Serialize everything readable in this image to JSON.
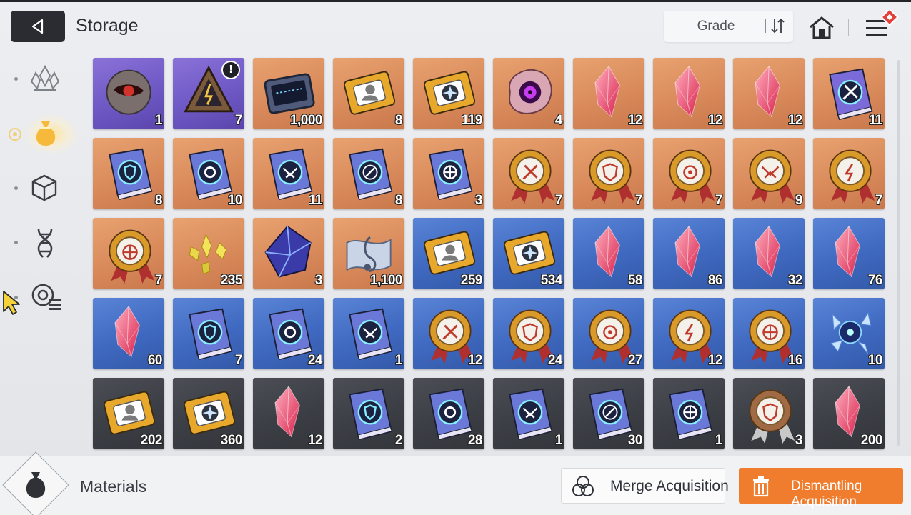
{
  "header": {
    "title": "Storage",
    "grade_label": "Grade"
  },
  "sidebar": {
    "items": [
      {
        "name": "crystals-tab",
        "icon": "crystal-cluster-icon",
        "active": false
      },
      {
        "name": "materials-tab",
        "icon": "pouch-icon",
        "active": true
      },
      {
        "name": "cube-tab",
        "icon": "cube-icon",
        "active": false
      },
      {
        "name": "dna-tab",
        "icon": "dna-icon",
        "active": false
      },
      {
        "name": "list-tab",
        "icon": "badge-list-icon",
        "active": false
      }
    ]
  },
  "items": [
    {
      "grade": "purple",
      "icon": "rock-orb-icon",
      "qty": "1"
    },
    {
      "grade": "purple",
      "icon": "triangle-core-icon",
      "qty": "7",
      "alert": "!"
    },
    {
      "grade": "orange",
      "icon": "chip-icon",
      "qty": "1,000"
    },
    {
      "grade": "orange",
      "icon": "portrait-ticket-icon",
      "qty": "8"
    },
    {
      "grade": "orange",
      "icon": "star-ticket-icon",
      "qty": "119"
    },
    {
      "grade": "orange",
      "icon": "eye-blob-icon",
      "qty": "4"
    },
    {
      "grade": "orange",
      "icon": "red-crystal-icon",
      "qty": "12"
    },
    {
      "grade": "orange",
      "icon": "amber-crystal-icon",
      "qty": "12"
    },
    {
      "grade": "orange",
      "icon": "violet-crystal-icon",
      "qty": "12"
    },
    {
      "grade": "orange",
      "icon": "sword-book-icon",
      "qty": "11"
    },
    {
      "grade": "orange",
      "icon": "shield-book-icon",
      "qty": "8"
    },
    {
      "grade": "orange",
      "icon": "target-book-icon",
      "qty": "10"
    },
    {
      "grade": "orange",
      "icon": "wing-book-icon",
      "qty": "11"
    },
    {
      "grade": "orange",
      "icon": "bolt-book-icon",
      "qty": "8"
    },
    {
      "grade": "orange",
      "icon": "circle-book-icon",
      "qty": "3"
    },
    {
      "grade": "orange",
      "icon": "sword-medal-icon",
      "qty": "7"
    },
    {
      "grade": "orange",
      "icon": "shield-medal-icon",
      "qty": "7"
    },
    {
      "grade": "orange",
      "icon": "target-medal-icon",
      "qty": "7"
    },
    {
      "grade": "orange",
      "icon": "wing-medal-icon",
      "qty": "9"
    },
    {
      "grade": "orange",
      "icon": "bolt-medal-icon",
      "qty": "7"
    },
    {
      "grade": "orange",
      "icon": "circle-medal-icon",
      "qty": "7"
    },
    {
      "grade": "orange",
      "icon": "shards-icon",
      "qty": "235"
    },
    {
      "grade": "orange",
      "icon": "blue-polyhedron-icon",
      "qty": "3"
    },
    {
      "grade": "orange",
      "icon": "music-scroll-icon",
      "qty": "1,100"
    },
    {
      "grade": "blue",
      "icon": "portrait-ticket-icon",
      "qty": "259"
    },
    {
      "grade": "blue",
      "icon": "star-ticket-icon",
      "qty": "534"
    },
    {
      "grade": "blue",
      "icon": "red-crystal-icon",
      "qty": "58"
    },
    {
      "grade": "blue",
      "icon": "amber-crystal-icon",
      "qty": "86"
    },
    {
      "grade": "blue",
      "icon": "violet-crystal-icon",
      "qty": "32"
    },
    {
      "grade": "blue",
      "icon": "green-crystal-icon",
      "qty": "76"
    },
    {
      "grade": "blue",
      "icon": "cyan-crystal-icon",
      "qty": "60"
    },
    {
      "grade": "blue",
      "icon": "shield-book-icon",
      "qty": "7"
    },
    {
      "grade": "blue",
      "icon": "target-book-icon",
      "qty": "24"
    },
    {
      "grade": "blue",
      "icon": "wing-book-icon",
      "qty": "1"
    },
    {
      "grade": "blue",
      "icon": "sword-medal-icon",
      "qty": "12"
    },
    {
      "grade": "blue",
      "icon": "shield-medal-icon",
      "qty": "24"
    },
    {
      "grade": "blue",
      "icon": "target-medal-icon",
      "qty": "27"
    },
    {
      "grade": "blue",
      "icon": "bolt-medal-icon",
      "qty": "12"
    },
    {
      "grade": "blue",
      "icon": "circle-medal-icon",
      "qty": "16"
    },
    {
      "grade": "blue",
      "icon": "shattered-orb-icon",
      "qty": "10"
    },
    {
      "grade": "gray",
      "icon": "portrait-ticket-icon",
      "qty": "202"
    },
    {
      "grade": "gray",
      "icon": "star-ticket-icon",
      "qty": "360"
    },
    {
      "grade": "gray",
      "icon": "ember-crystal-icon",
      "qty": "12"
    },
    {
      "grade": "gray",
      "icon": "shield-book-icon",
      "qty": "2"
    },
    {
      "grade": "gray",
      "icon": "target-book-icon",
      "qty": "28"
    },
    {
      "grade": "gray",
      "icon": "wing-book-icon",
      "qty": "1"
    },
    {
      "grade": "gray",
      "icon": "bolt-book-icon",
      "qty": "30"
    },
    {
      "grade": "gray",
      "icon": "circle-book-icon",
      "qty": "1"
    },
    {
      "grade": "gray",
      "icon": "bronze-medal-icon",
      "qty": "3"
    },
    {
      "grade": "gray",
      "icon": "prism-crystal-icon",
      "qty": "200"
    }
  ],
  "footer": {
    "category_label": "Materials",
    "merge_label": "Merge Acquisition",
    "dismantle_label": "Dismantling Acquisition"
  },
  "colors": {
    "orange_grade": "#d98a5b",
    "purple_grade": "#6e58c4",
    "blue_grade": "#3f69c0",
    "gray_grade": "#3b3e44",
    "accent_orange": "#f07d2e",
    "menu_badge": "#e0413a"
  }
}
